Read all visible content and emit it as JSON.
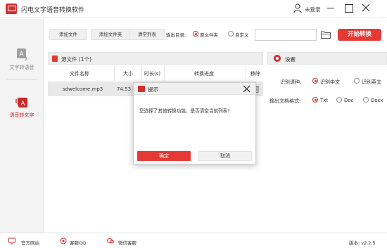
{
  "app": {
    "title": "闪电文字语音转换软件",
    "user_label": "未登录",
    "accent": "#e53935"
  },
  "sidebar": {
    "items": [
      {
        "label": "文字转语音",
        "icon": "text-to-speech-icon",
        "active": false
      },
      {
        "label": "语音转文字",
        "icon": "speech-to-text-icon",
        "active": true
      }
    ]
  },
  "toolbar": {
    "add_file": "添加文件",
    "add_folder": "添加文件夹",
    "clear_list": "清空列表",
    "output_dir_label": "输出目录:",
    "radio_source": "原文件夹",
    "radio_custom": "自定义",
    "path_value": "",
    "start_label": "开始转换"
  },
  "files": {
    "panel_title": "源文件 (1个)",
    "columns": [
      "文件名称",
      "大小",
      "时长(s)",
      "转换进度",
      "移除"
    ],
    "rows": [
      {
        "name": "sdwelcome.mp3",
        "size": "74.53 K"
      }
    ]
  },
  "settings": {
    "title": "设置",
    "language_label": "识别语种:",
    "lang_options": [
      "识别中文",
      "识别英文"
    ],
    "lang_selected": 0,
    "format_label": "输出文档格式:",
    "format_options": [
      "Txt",
      "Doc",
      "Docx"
    ],
    "format_selected": 0
  },
  "footer": {
    "website": "官方网站",
    "qq": "客服QQ",
    "wechat": "微信客服",
    "version": "版本: v2.2.5"
  },
  "dialog": {
    "title": "提示",
    "message": "您选择了其他转换功能，是否清空当前列表?",
    "ok": "确定",
    "cancel": "取消"
  }
}
